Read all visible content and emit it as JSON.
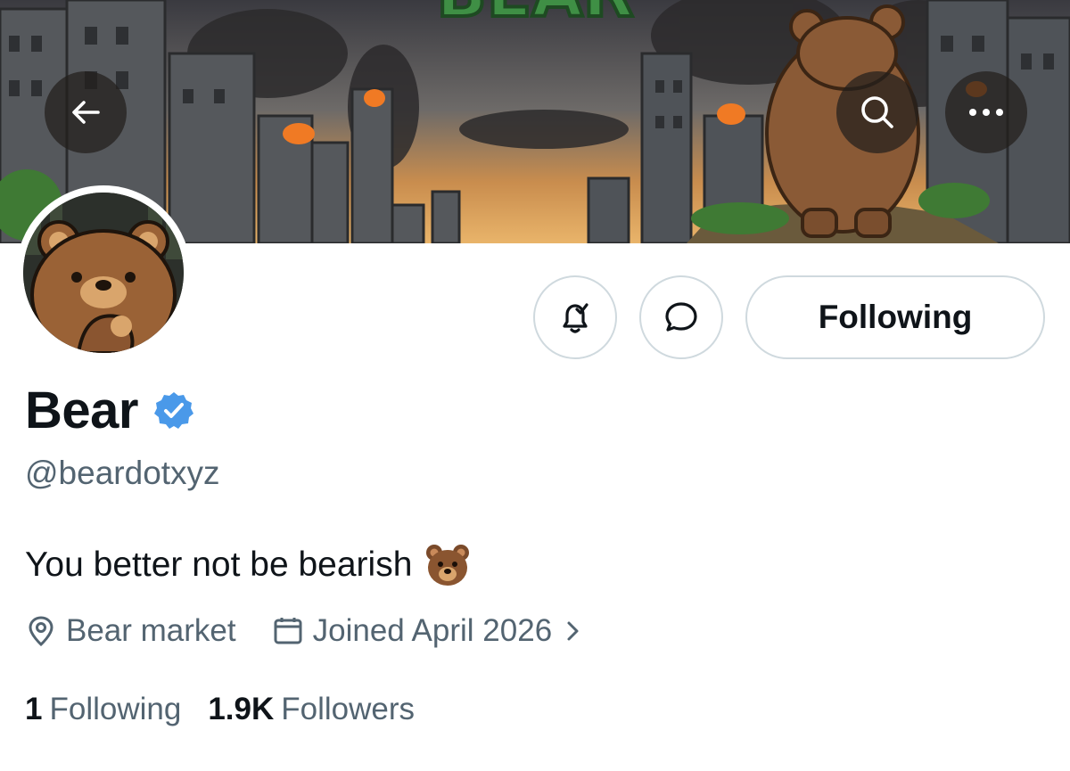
{
  "banner": {
    "title_text": "BEAR",
    "colors": {
      "sky_top": "#3c3a3e",
      "sky_glow": "#d9a15a",
      "title_green": "#3f8f45"
    }
  },
  "header": {
    "back_icon": "arrow-left-icon",
    "search_icon": "search-icon",
    "more_icon": "more-dots-icon"
  },
  "actions": {
    "notify_icon": "bell-check-icon",
    "message_icon": "message-bubble-icon",
    "follow_label": "Following"
  },
  "profile": {
    "display_name": "Bear",
    "verified": true,
    "verified_color": "#4a99e9",
    "handle": "@beardotxyz",
    "bio": "You better not be bearish",
    "bio_emoji": "bear-face-emoji",
    "location": "Bear market",
    "joined": "Joined April 2026"
  },
  "stats": {
    "following_count": "1",
    "following_label": "Following",
    "followers_count": "1.9K",
    "followers_label": "Followers"
  }
}
